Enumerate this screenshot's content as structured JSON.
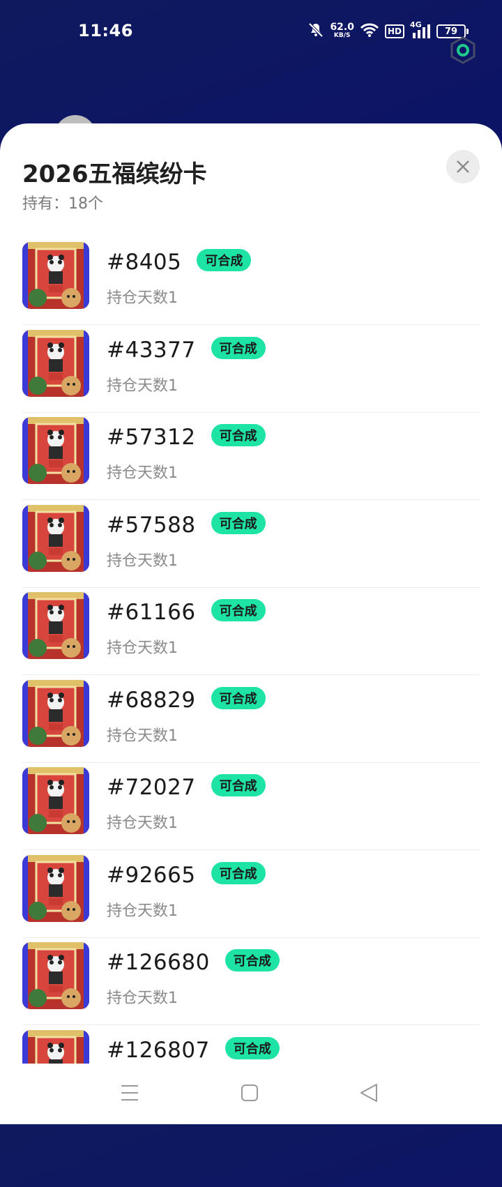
{
  "status_bar": {
    "time": "11:46",
    "net_speed_value": "62.0",
    "net_speed_unit": "KB/S",
    "hd_label": "HD",
    "network_label": "4G",
    "battery_level": "79"
  },
  "sheet": {
    "title": "2026五福缤纷卡",
    "subtitle": "持有：18个"
  },
  "cards": [
    {
      "id": "#8405",
      "badge": "可合成",
      "holding": "持仓天数1"
    },
    {
      "id": "#43377",
      "badge": "可合成",
      "holding": "持仓天数1"
    },
    {
      "id": "#57312",
      "badge": "可合成",
      "holding": "持仓天数1"
    },
    {
      "id": "#57588",
      "badge": "可合成",
      "holding": "持仓天数1"
    },
    {
      "id": "#61166",
      "badge": "可合成",
      "holding": "持仓天数1"
    },
    {
      "id": "#68829",
      "badge": "可合成",
      "holding": "持仓天数1"
    },
    {
      "id": "#72027",
      "badge": "可合成",
      "holding": "持仓天数1"
    },
    {
      "id": "#92665",
      "badge": "可合成",
      "holding": "持仓天数1"
    },
    {
      "id": "#126680",
      "badge": "可合成",
      "holding": "持仓天数1"
    },
    {
      "id": "#126807",
      "badge": "可合成",
      "holding": ""
    }
  ],
  "colors": {
    "badge_bg": "#1de4a5",
    "sheet_bg": "#ffffff",
    "header_bg": "#0a0f6b"
  },
  "icons": {
    "close": "close-icon",
    "menu": "menu-icon",
    "home": "home-icon",
    "back": "back-icon",
    "mute": "bell-off-icon",
    "wifi": "wifi-icon",
    "signal": "signal-icon",
    "battery": "battery-icon",
    "overlay": "hexagon-overlay-icon"
  }
}
